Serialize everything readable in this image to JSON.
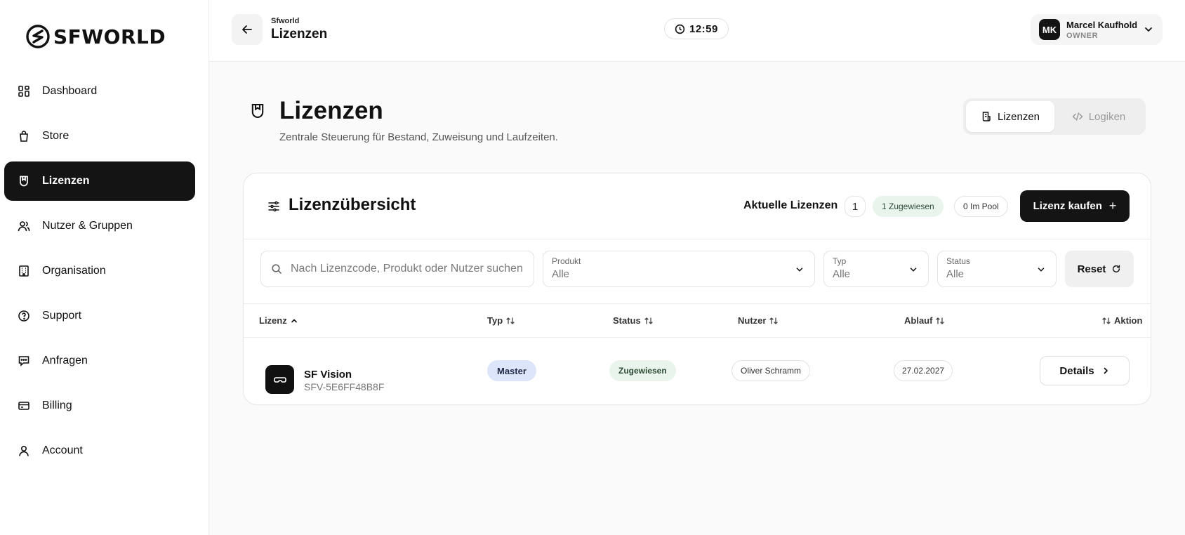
{
  "brand": {
    "logo_text": "SFWORLD"
  },
  "sidebar": {
    "items": [
      {
        "label": "Dashboard",
        "icon": "dashboard-icon"
      },
      {
        "label": "Store",
        "icon": "bag-icon"
      },
      {
        "label": "Lizenzen",
        "icon": "shield-icon",
        "active": true
      },
      {
        "label": "Nutzer & Gruppen",
        "icon": "users-icon"
      },
      {
        "label": "Organisation",
        "icon": "building-icon"
      },
      {
        "label": "Support",
        "icon": "help-icon"
      },
      {
        "label": "Anfragen",
        "icon": "chat-icon"
      },
      {
        "label": "Billing",
        "icon": "card-icon"
      },
      {
        "label": "Account",
        "icon": "user-icon"
      }
    ]
  },
  "header": {
    "small": "Sfworld",
    "title": "Lizenzen",
    "time": "12:59",
    "user": {
      "initials": "MK",
      "name": "Marcel Kaufhold",
      "role": "OWNER"
    }
  },
  "page": {
    "title": "Lizenzen",
    "subtitle": "Zentrale Steuerung für Bestand, Zuweisung und Laufzeiten.",
    "tabs": [
      {
        "label": "Lizenzen",
        "active": true
      },
      {
        "label": "Logiken",
        "active": false
      }
    ]
  },
  "card": {
    "title": "Lizenzübersicht",
    "current_label": "Aktuelle Lizenzen",
    "current_count": "1",
    "assigned_pill": "1 Zugewiesen",
    "pool_pill": "0 Im Pool",
    "buy_label": "Lizenz kaufen",
    "search_placeholder": "Nach Lizenzcode, Produkt oder Nutzer suchen",
    "filters": {
      "product": {
        "label": "Produkt",
        "value": "Alle"
      },
      "type": {
        "label": "Typ",
        "value": "Alle"
      },
      "status": {
        "label": "Status",
        "value": "Alle"
      },
      "reset": "Reset"
    },
    "columns": {
      "license": "Lizenz",
      "type": "Typ",
      "status": "Status",
      "user": "Nutzer",
      "expiry": "Ablauf",
      "action": "Aktion"
    },
    "rows": [
      {
        "product": "SF Vision",
        "code": "SFV-5E6FF48B8F",
        "type": "Master",
        "status": "Zugewiesen",
        "user": "Oliver Schramm",
        "expiry": "27.02.2027",
        "action": "Details"
      }
    ]
  },
  "colors": {
    "accent": "#141414",
    "green_bg": "#e8f4ec",
    "blue_bg": "#dde5fb"
  }
}
